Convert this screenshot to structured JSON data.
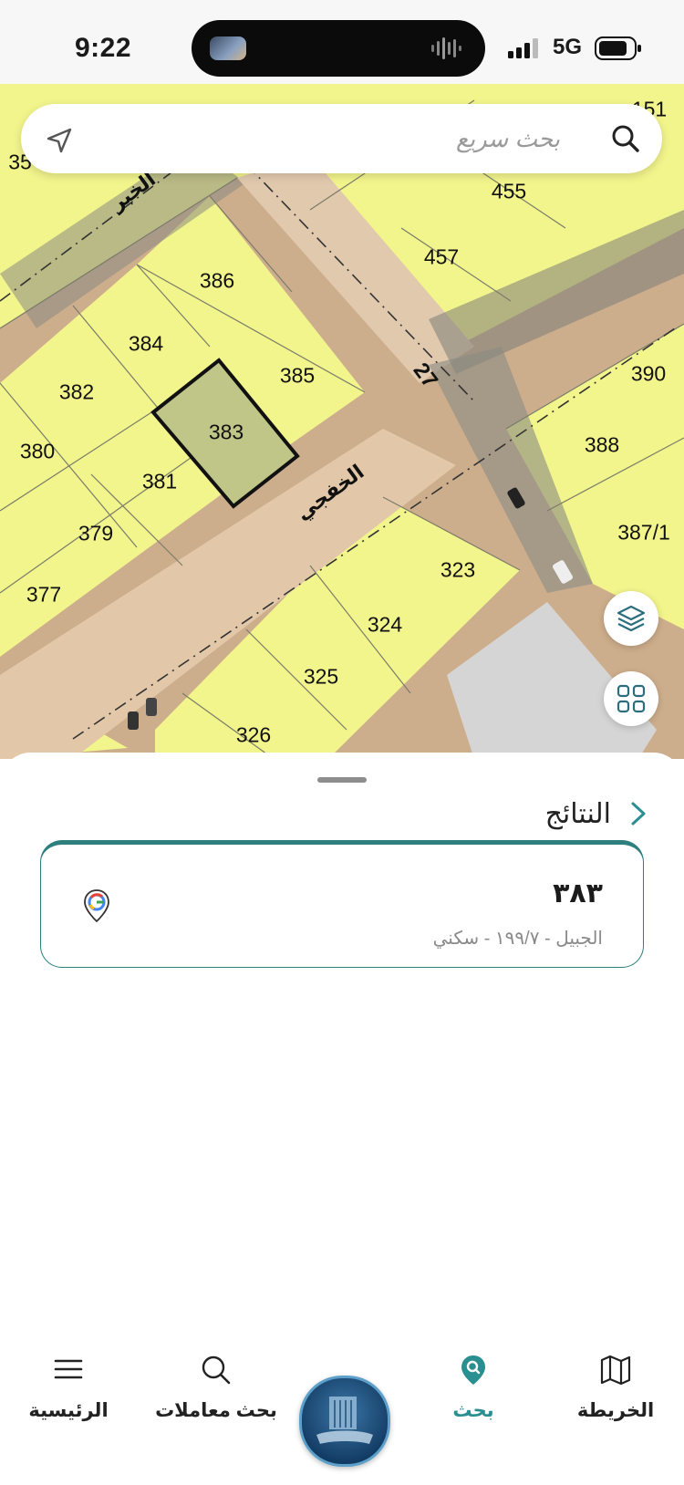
{
  "status_bar": {
    "time": "9:22",
    "network": "5G"
  },
  "search": {
    "placeholder": "بحث سريع"
  },
  "map": {
    "lots": [
      "386",
      "384",
      "385",
      "382",
      "383",
      "380",
      "381",
      "379",
      "377",
      "457",
      "455",
      "390",
      "388",
      "387/1",
      "323",
      "324",
      "325",
      "326",
      "151",
      "35"
    ],
    "roads": {
      "khafji": "الخفجي",
      "khobar": "الخبر",
      "number": "27"
    },
    "selected_lot": "383"
  },
  "sheet": {
    "title": "النتائج",
    "result": {
      "name": "٣٨٣",
      "subtitle": "الجبيل - ١٩٩/٧ - سكني"
    }
  },
  "nav": {
    "items": [
      {
        "label": "الخريطة",
        "icon": "map-icon"
      },
      {
        "label": "بحث",
        "icon": "search-pin-icon"
      },
      {
        "label": "بحث معاملات",
        "icon": "search-icon"
      },
      {
        "label": "الرئيسية",
        "icon": "menu-icon"
      }
    ]
  },
  "colors": {
    "accent": "#2a8f91",
    "parcel": "#f3f58f",
    "selected_parcel": "#bfc688"
  }
}
